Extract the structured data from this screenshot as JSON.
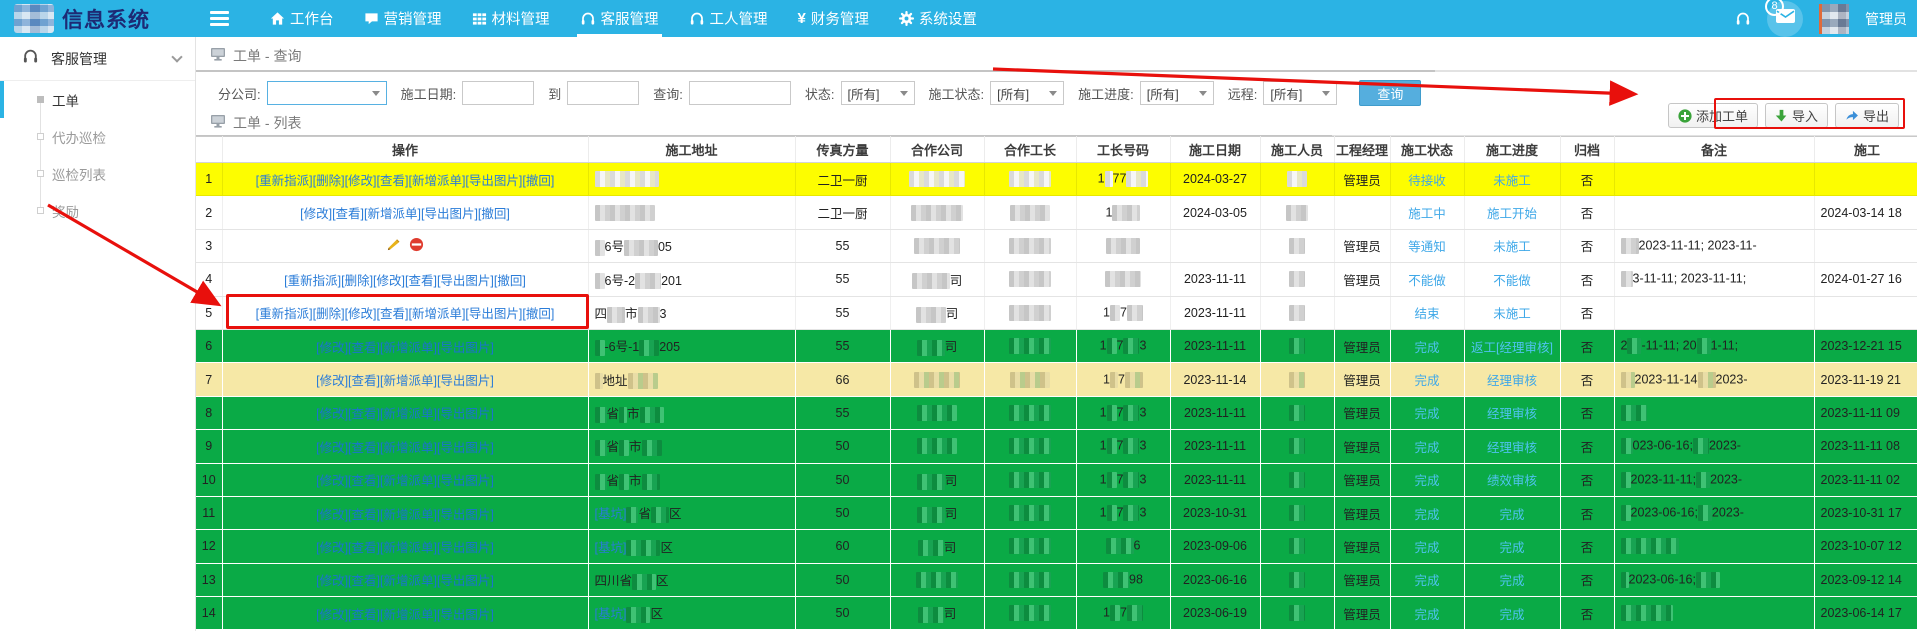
{
  "topbar": {
    "logo_text": "信息系统",
    "nav": [
      {
        "label": "工作台",
        "icon": "home-icon",
        "active": false
      },
      {
        "label": "营销管理",
        "icon": "chat-icon",
        "active": false
      },
      {
        "label": "材料管理",
        "icon": "grid-icon",
        "active": false
      },
      {
        "label": "客服管理",
        "icon": "headset-icon",
        "active": true
      },
      {
        "label": "工人管理",
        "icon": "headset-icon",
        "active": false
      },
      {
        "label": "财务管理",
        "icon": "yen-icon",
        "active": false
      },
      {
        "label": "系统设置",
        "icon": "gear-icon",
        "active": false
      }
    ],
    "badge_count": "8",
    "user_name": "管理员"
  },
  "sidebar": {
    "section_label": "客服管理",
    "items": [
      {
        "label": "工单",
        "active": true
      },
      {
        "label": "代办巡检",
        "active": false
      },
      {
        "label": "巡检列表",
        "active": false
      },
      {
        "label": "奖励",
        "active": false
      }
    ]
  },
  "query_panel": {
    "title": "工单 - 查询",
    "company_label": "分公司:",
    "date_label": "施工日期:",
    "to_label": "到",
    "search_label": "查询:",
    "status_label": "状态:",
    "cstatus_label": "施工状态:",
    "progress_label": "施工进度:",
    "remote_label": "远程:",
    "select_all": "[所有]",
    "query_button": "查询"
  },
  "list_panel": {
    "title": "工单 - 列表",
    "buttons": [
      {
        "label": "添加工单",
        "icon": "plus-circle-icon"
      },
      {
        "label": "导入",
        "icon": "import-icon"
      },
      {
        "label": "导出",
        "icon": "export-icon"
      }
    ]
  },
  "table": {
    "headers": [
      "",
      "操作",
      "施工地址",
      "传真方量",
      "合作公司",
      "合作工长",
      "工长号码",
      "施工日期",
      "施工人员",
      "工程经理",
      "施工状态",
      "施工进度",
      "归档",
      "备注",
      "施工"
    ],
    "rows": [
      {
        "n": "1",
        "tone": "yellow",
        "ops": [
          "重新指派",
          "删除",
          "修改",
          "查看",
          "新增派单",
          "导出图片",
          "撤回"
        ],
        "addr": [
          {
            "c": 64
          }
        ],
        "vol": "二卫一厨",
        "company": [
          {
            "c": 56
          }
        ],
        "foreman": [
          {
            "c": 42
          }
        ],
        "phone": [
          {
            "t": "1"
          },
          {
            "c": 8
          },
          {
            "t": "77"
          },
          {
            "c": 22
          }
        ],
        "date": "2024-03-27",
        "worker": [
          {
            "c": 20
          }
        ],
        "manager": "管理员",
        "status": "待接收",
        "progress": "未施工",
        "archive": "否",
        "remark": [],
        "end": ""
      },
      {
        "n": "2",
        "tone": "white",
        "ops": [
          "修改",
          "查看",
          "新增派单",
          "导出图片",
          "撤回"
        ],
        "addr": [
          {
            "c": 60
          }
        ],
        "vol": "二卫一厨",
        "company": [
          {
            "c": 52
          }
        ],
        "foreman": [
          {
            "c": 40
          }
        ],
        "phone": [
          {
            "t": "1"
          },
          {
            "c": 28
          }
        ],
        "date": "2024-03-05",
        "worker": [
          {
            "c": 22
          }
        ],
        "manager": "",
        "status": "施工中",
        "progress": "施工开始",
        "archive": "否",
        "remark": [],
        "end": "2024-03-14 18"
      },
      {
        "n": "3",
        "tone": "white",
        "ops_icons": true,
        "addr": [
          {
            "c": 10
          },
          {
            "t": "6号"
          },
          {
            "c": 34
          },
          {
            "t": "05"
          }
        ],
        "vol": "55",
        "company": [
          {
            "c": 46
          }
        ],
        "foreman": [
          {
            "c": 42
          }
        ],
        "phone": [
          {
            "c": 34
          }
        ],
        "date": "",
        "worker": [
          {
            "c": 16
          }
        ],
        "manager": "管理员",
        "status": "等通知",
        "progress": "未施工",
        "archive": "否",
        "remark": [
          {
            "c": 18
          },
          {
            "t": "2023-11-11; 2023-11-"
          }
        ],
        "end": ""
      },
      {
        "n": "4",
        "tone": "white",
        "ops": [
          "重新指派",
          "删除",
          "修改",
          "查看",
          "导出图片",
          "撤回"
        ],
        "addr": [
          {
            "c": 10
          },
          {
            "t": "6号-2"
          },
          {
            "c": 26
          },
          {
            "t": "201"
          }
        ],
        "vol": "55",
        "company": [
          {
            "c": 38
          },
          {
            "t": "司"
          }
        ],
        "foreman": [
          {
            "c": 42
          }
        ],
        "phone": [
          {
            "c": 36
          }
        ],
        "date": "2023-11-11",
        "worker": [
          {
            "c": 16
          }
        ],
        "manager": "管理员",
        "status": "不能做",
        "progress": "不能做",
        "archive": "否",
        "remark": [
          {
            "c": 12
          },
          {
            "t": "3-11-11; 2023-11-11;"
          }
        ],
        "end": "2024-01-27 16"
      },
      {
        "n": "5",
        "tone": "white",
        "ops": [
          "重新指派",
          "删除",
          "修改",
          "查看",
          "新增派单",
          "导出图片",
          "撤回"
        ],
        "addr": [
          {
            "t": "四"
          },
          {
            "c": 18
          },
          {
            "t": "市"
          },
          {
            "c": 22
          },
          {
            "t": "3"
          }
        ],
        "vol": "55",
        "company": [
          {
            "c": 30
          },
          {
            "t": "司"
          }
        ],
        "foreman": [
          {
            "c": 42
          }
        ],
        "phone": [
          {
            "t": "1"
          },
          {
            "c": 10
          },
          {
            "t": "7"
          },
          {
            "c": 16
          }
        ],
        "date": "2023-11-11",
        "worker": [
          {
            "c": 16
          }
        ],
        "manager": "",
        "status": "结束",
        "progress": "未施工",
        "archive": "否",
        "remark": [],
        "end": ""
      },
      {
        "n": "6",
        "tone": "green",
        "ops": [
          "修改",
          "查看",
          "新增派单",
          "导出图片"
        ],
        "addr": [
          {
            "c": 10
          },
          {
            "t": "-6号-1"
          },
          {
            "c": 20
          },
          {
            "t": "205"
          }
        ],
        "vol": "55",
        "company": [
          {
            "c": 28
          },
          {
            "t": "司"
          }
        ],
        "foreman": [
          {
            "c": 42
          }
        ],
        "phone": [
          {
            "t": "1"
          },
          {
            "c": 10
          },
          {
            "t": "7"
          },
          {
            "c": 16
          },
          {
            "t": "3"
          }
        ],
        "date": "2023-11-11",
        "worker": [
          {
            "c": 16
          }
        ],
        "manager": "管理员",
        "status": "完成",
        "progress": "返工[经理审核]",
        "archive": "否",
        "remark": [
          {
            "t": "2"
          },
          {
            "c": 14
          },
          {
            "t": "-11-11; 20"
          },
          {
            "c": 14
          },
          {
            "t": "1-11;"
          }
        ],
        "end": "2023-12-21 15"
      },
      {
        "n": "7",
        "tone": "cream",
        "ops": [
          "修改",
          "查看",
          "新增派单",
          "导出图片"
        ],
        "addr": [
          {
            "c": 8
          },
          {
            "t": "地址"
          },
          {
            "c": 30
          }
        ],
        "vol": "66",
        "company": [
          {
            "c": 46
          }
        ],
        "foreman": [
          {
            "c": 40
          }
        ],
        "phone": [
          {
            "t": "1"
          },
          {
            "c": 8
          },
          {
            "t": "7"
          },
          {
            "c": 18
          }
        ],
        "date": "2023-11-14",
        "worker": [
          {
            "c": 16
          }
        ],
        "manager": "管理员",
        "status": "完成",
        "progress": "经理审核",
        "archive": "否",
        "remark": [
          {
            "c": 14
          },
          {
            "t": "2023-11-14"
          },
          {
            "c": 18
          },
          {
            "t": "2023-"
          }
        ],
        "end": "2023-11-19 21"
      },
      {
        "n": "8",
        "tone": "green",
        "ops": [
          "修改",
          "查看",
          "新增派单",
          "导出图片"
        ],
        "addr": [
          {
            "c": 12
          },
          {
            "t": "省"
          },
          {
            "c": 8
          },
          {
            "t": "市"
          },
          {
            "c": 24
          }
        ],
        "vol": "55",
        "company": [
          {
            "c": 40
          }
        ],
        "foreman": [
          {
            "c": 42
          }
        ],
        "phone": [
          {
            "t": "1"
          },
          {
            "c": 10
          },
          {
            "t": "7"
          },
          {
            "c": 16
          },
          {
            "t": "3"
          }
        ],
        "date": "2023-11-11",
        "worker": [
          {
            "c": 16
          }
        ],
        "manager": "管理员",
        "status": "完成",
        "progress": "经理审核",
        "archive": "否",
        "remark": [
          {
            "c": 26
          }
        ],
        "end": "2023-11-11 09"
      },
      {
        "n": "9",
        "tone": "green",
        "ops": [
          "修改",
          "查看",
          "新增派单",
          "导出图片"
        ],
        "addr": [
          {
            "c": 12
          },
          {
            "t": "省"
          },
          {
            "c": 10
          },
          {
            "t": "市"
          },
          {
            "c": 20
          }
        ],
        "vol": "50",
        "company": [
          {
            "c": 40
          }
        ],
        "foreman": [
          {
            "c": 42
          }
        ],
        "phone": [
          {
            "t": "1"
          },
          {
            "c": 10
          },
          {
            "t": "7"
          },
          {
            "c": 16
          },
          {
            "t": "3"
          }
        ],
        "date": "2023-11-11",
        "worker": [
          {
            "c": 16
          }
        ],
        "manager": "管理员",
        "status": "完成",
        "progress": "经理审核",
        "archive": "否",
        "remark": [
          {
            "c": 12
          },
          {
            "t": "023-06-16;"
          },
          {
            "c": 16
          },
          {
            "t": "2023-"
          }
        ],
        "end": "2023-11-11 08"
      },
      {
        "n": "10",
        "tone": "green",
        "ops": [
          "修改",
          "查看",
          "新增派单",
          "导出图片"
        ],
        "addr": [
          {
            "c": 12
          },
          {
            "t": "省"
          },
          {
            "c": 10
          },
          {
            "t": "市"
          },
          {
            "c": 18
          }
        ],
        "vol": "50",
        "company": [
          {
            "c": 28
          },
          {
            "t": "司"
          }
        ],
        "foreman": [
          {
            "c": 42
          }
        ],
        "phone": [
          {
            "t": "1"
          },
          {
            "c": 10
          },
          {
            "t": "7"
          },
          {
            "c": 16
          },
          {
            "t": "3"
          }
        ],
        "date": "2023-11-11",
        "worker": [
          {
            "c": 16
          }
        ],
        "manager": "管理员",
        "status": "完成",
        "progress": "绩效审核",
        "archive": "否",
        "remark": [
          {
            "c": 10
          },
          {
            "t": "2023-11-11;"
          },
          {
            "c": 14
          },
          {
            "t": "2023-"
          }
        ],
        "end": "2023-11-11 02"
      },
      {
        "n": "11",
        "tone": "green",
        "ops": [
          "修改",
          "查看",
          "新增派单",
          "导出图片"
        ],
        "addr": [
          {
            "t": "[基坑]",
            "cls": "tag"
          },
          {
            "c": 12
          },
          {
            "t": "省"
          },
          {
            "c": 18
          },
          {
            "t": "区"
          }
        ],
        "vol": "50",
        "company": [
          {
            "c": 28
          },
          {
            "t": "司"
          }
        ],
        "foreman": [
          {
            "c": 42
          }
        ],
        "phone": [
          {
            "t": "1"
          },
          {
            "c": 10
          },
          {
            "t": "7"
          },
          {
            "c": 16
          },
          {
            "t": "3"
          }
        ],
        "date": "2023-10-31",
        "worker": [
          {
            "c": 16
          }
        ],
        "manager": "管理员",
        "status": "完成",
        "progress": "完成",
        "archive": "否",
        "remark": [
          {
            "c": 10
          },
          {
            "t": "2023-06-16;"
          },
          {
            "c": 14
          },
          {
            "t": "2023-"
          }
        ],
        "end": "2023-10-31 17"
      },
      {
        "n": "12",
        "tone": "green",
        "ops": [
          "修改",
          "查看",
          "新增派单",
          "导出图片"
        ],
        "addr": [
          {
            "t": "[基坑]",
            "cls": "tag"
          },
          {
            "c": 34
          },
          {
            "t": "区"
          }
        ],
        "vol": "60",
        "company": [
          {
            "c": 26
          },
          {
            "t": "司"
          }
        ],
        "foreman": [
          {
            "c": 42
          }
        ],
        "phone": [
          {
            "c": 28
          },
          {
            "t": "6"
          }
        ],
        "date": "2023-09-06",
        "worker": [
          {
            "c": 16
          }
        ],
        "manager": "管理员",
        "status": "完成",
        "progress": "完成",
        "archive": "否",
        "remark": [
          {
            "c": 58
          }
        ],
        "end": "2023-10-07 12"
      },
      {
        "n": "13",
        "tone": "green",
        "ops": [
          "修改",
          "查看",
          "新增派单",
          "导出图片"
        ],
        "addr": [
          {
            "t": "四川省"
          },
          {
            "c": 24
          },
          {
            "t": "区"
          }
        ],
        "vol": "50",
        "company": [
          {
            "c": 42
          }
        ],
        "foreman": [
          {
            "c": 42
          }
        ],
        "phone": [
          {
            "c": 26
          },
          {
            "t": "98"
          }
        ],
        "date": "2023-06-16",
        "worker": [
          {
            "c": 16
          }
        ],
        "manager": "管理员",
        "status": "完成",
        "progress": "完成",
        "archive": "否",
        "remark": [
          {
            "c": 8
          },
          {
            "t": "2023-06-16;"
          },
          {
            "c": 24
          }
        ],
        "end": "2023-09-12 14"
      },
      {
        "n": "14",
        "tone": "green",
        "ops": [
          "修改",
          "查看",
          "新增派单",
          "导出图片"
        ],
        "addr": [
          {
            "t": "[基坑]",
            "cls": "tag"
          },
          {
            "c": 24
          },
          {
            "t": "区"
          }
        ],
        "vol": "50",
        "company": [
          {
            "c": 26
          },
          {
            "t": "司"
          }
        ],
        "foreman": [
          {
            "c": 42
          }
        ],
        "phone": [
          {
            "t": "1"
          },
          {
            "c": 10
          },
          {
            "t": "7"
          },
          {
            "c": 16
          }
        ],
        "date": "2023-06-19",
        "worker": [
          {
            "c": 16
          }
        ],
        "manager": "管理员",
        "status": "完成",
        "progress": "完成",
        "archive": "否",
        "remark": [
          {
            "c": 52
          }
        ],
        "end": "2023-06-14 17"
      }
    ]
  }
}
